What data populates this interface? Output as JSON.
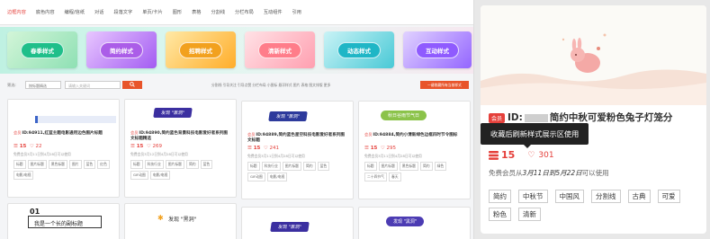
{
  "tabs": [
    {
      "label": "边框内容",
      "active": true
    },
    {
      "label": "底色内容"
    },
    {
      "label": "编程/信纸"
    },
    {
      "label": "对话"
    },
    {
      "label": "段落文字"
    },
    {
      "label": "单页/卡片"
    },
    {
      "label": "图形"
    },
    {
      "label": "表格"
    },
    {
      "label": "分割线"
    },
    {
      "label": "分栏布局"
    },
    {
      "label": "互动组件"
    },
    {
      "label": "引用"
    }
  ],
  "banner_cards": [
    {
      "label": "春季样式",
      "pill": "#1fbf8a",
      "bg": "linear-gradient(135deg,#d3f5d8,#8ee0b4)"
    },
    {
      "label": "简约样式",
      "pill": "#ab5de8",
      "bg": "linear-gradient(135deg,#e8c7ff,#a35cf2)"
    },
    {
      "label": "招聘样式",
      "pill": "#f2a11e",
      "bg": "linear-gradient(135deg,#ffe9a6,#ffad2a)"
    },
    {
      "label": "清新样式",
      "pill": "#ff7d8a",
      "bg": "linear-gradient(135deg,#ffe2e6,#ff9fb0)"
    },
    {
      "label": "动态样式",
      "pill": "#1fb6c6",
      "bg": "linear-gradient(135deg,#c9f3f6,#49c9d6)"
    },
    {
      "label": "互动样式",
      "pill": "#8f5bff",
      "bg": "linear-gradient(135deg,#e1d2ff,#9466ff)"
    }
  ],
  "filters": {
    "label": "筛选:",
    "select_value": "按标题精选",
    "search_placeholder": "请输入关键词",
    "search_icon": "search-icon",
    "quick_tags": "分割线  引导关注  引导点赞  分栏布局  小图标  悬浮样式  图片  表格  图文排版  更多",
    "right_button": "一键收藏所有当前样式"
  },
  "cards": [
    {
      "pic_text": "",
      "title": "ID:94911,红蓝主题电影通用边色图片标题",
      "views": "15",
      "likes": "22",
      "note": "免费会员3月11日到4月28日可以使用",
      "tags": [
        "标题",
        "图片标题",
        "黑色标题",
        "图片",
        "蓝色",
        "红色",
        "电影/电视"
      ]
    },
    {
      "pic_text": "发现 \"黑洞\"",
      "title": "ID:94890,简约蓝色背景科技电影爱好者系列图文标题精选",
      "views": "15",
      "likes": "269",
      "note": "免费会员3月12日到4月28日可以使用",
      "tags": [
        "标题",
        "科技行业",
        "图片标题",
        "简约",
        "蓝色",
        "GIF动图",
        "电影/电视"
      ]
    },
    {
      "pic_text": "发现 \"黑洞\"",
      "title": "ID:94889,简约蓝色星空科技电影爱好者系列图文标题",
      "views": "15",
      "likes": "241",
      "note": "免费会员3月11日到4月28日可以使用",
      "tags": [
        "标题",
        "科技行业",
        "图片标题",
        "简约",
        "蓝色",
        "GIF动图",
        "电影/电视"
      ]
    },
    {
      "pic_text": "秋日谷雨节气日",
      "title": "ID:94884,简约小清新绿色边框四时节令图标",
      "views": "15",
      "likes": "295",
      "note": "免费会员3月11日到4月28日可以使用",
      "tags": [
        "标题",
        "图片标题",
        "黑色标题",
        "简约",
        "绿色",
        "二十四节气",
        "春天"
      ]
    }
  ],
  "bottom_cards": [
    {
      "text": "我是一个长的副标题",
      "num": "01"
    },
    {
      "text": "发现 \"黑洞\""
    },
    {
      "text": "发现 \"黑洞\""
    },
    {
      "text": "发现 \"黑洞\""
    }
  ],
  "detail": {
    "vip_badge": "会员",
    "title_prefix": "ID:",
    "title_rest": "简约中秋可爱粉色兔子灯笼分",
    "tooltip": "收藏后刷新样式展示区使用",
    "views": "15",
    "likes": "301",
    "note_prefix": "免费会员从",
    "note_date": "3月11日到5月22日",
    "note_suffix": "可以使用",
    "tags": [
      "简约",
      "中秋节",
      "中国风",
      "分割线",
      "古典",
      "可爱",
      "粉色",
      "清新"
    ]
  },
  "icons": {
    "views": "stack-icon",
    "likes": "heart-icon"
  }
}
